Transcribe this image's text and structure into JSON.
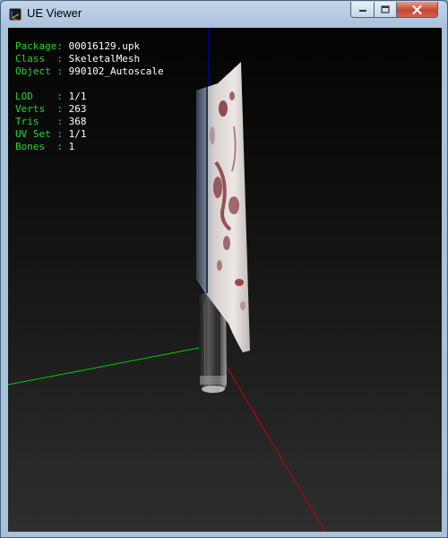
{
  "window": {
    "title": "UE Viewer"
  },
  "info": {
    "package": {
      "label": "Package: ",
      "value": "00016129.upk"
    },
    "class": {
      "label": "Class  : ",
      "value": "SkeletalMesh"
    },
    "object": {
      "label": "Object : ",
      "value": "990102_Autoscale"
    },
    "lod": {
      "label": "LOD    : ",
      "value": "1/1"
    },
    "verts": {
      "label": "Verts  : ",
      "value": "263"
    },
    "tris": {
      "label": "Tris   : ",
      "value": "368"
    },
    "uvset": {
      "label": "UV Set : ",
      "value": "1/1"
    },
    "bones": {
      "label": "Bones  : ",
      "value": "1"
    }
  },
  "colors": {
    "axis_x": "#cc0000",
    "axis_y": "#00cc00",
    "axis_z": "#0000cc",
    "label_text": "#27d827",
    "value_text": "#ffffff"
  },
  "icons": {
    "app": "ue-viewer-app-icon",
    "minimize": "minimize-icon",
    "maximize": "maximize-icon",
    "close": "close-icon"
  }
}
